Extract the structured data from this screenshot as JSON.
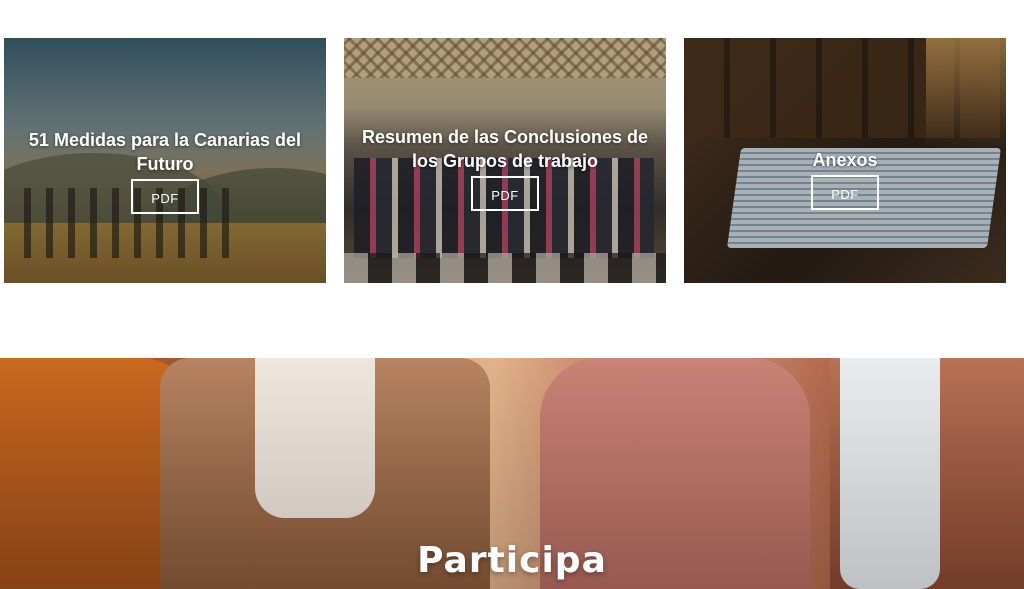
{
  "cards": [
    {
      "title": "51 Medidas para la Canarias del Futuro",
      "button_label": "PDF"
    },
    {
      "title": "Resumen de las Conclusiones de los Grupos de trabajo",
      "button_label": "PDF"
    },
    {
      "title": "Anexos",
      "button_label": "PDF"
    }
  ],
  "participa": {
    "title": "Participa"
  }
}
